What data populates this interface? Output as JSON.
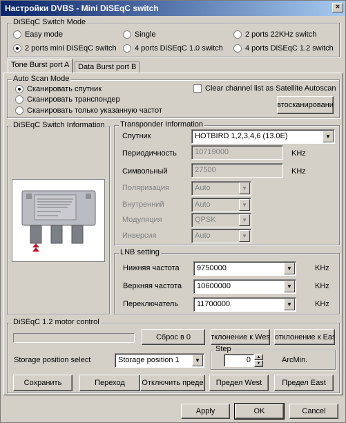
{
  "window": {
    "title": "Настройки DVBS - Mini DiSEqC switch",
    "close_glyph": "×"
  },
  "switch_mode": {
    "legend": "DiSEqC Switch Mode",
    "options": [
      {
        "label": "Easy mode",
        "checked": false
      },
      {
        "label": "Single",
        "checked": false
      },
      {
        "label": "2 ports 22KHz switch",
        "checked": false
      },
      {
        "label": "2 ports mini DiSEqC switch",
        "checked": true
      },
      {
        "label": "4 ports DiSEqC 1.0 switch",
        "checked": false
      },
      {
        "label": "4 ports DiSEqC 1.2 switch",
        "checked": false
      }
    ]
  },
  "tabs": [
    {
      "label": "Tone Burst port A",
      "active": true
    },
    {
      "label": "Data Burst port B",
      "active": false
    }
  ],
  "auto_scan": {
    "legend": "Auto Scan Mode",
    "options": [
      {
        "label": "Сканировать спутник",
        "checked": true
      },
      {
        "label": "Сканировать транспондер",
        "checked": false
      },
      {
        "label": "Сканировать только указанную частот",
        "checked": false
      }
    ],
    "clear_list_label": "Clear channel list as Satellite Autoscan",
    "autoscan_button": "втосканировани"
  },
  "switch_info": {
    "legend": "DiSEqC Switch Information"
  },
  "transponder": {
    "legend": "Transponder Information",
    "satellite_label": "Спутник",
    "satellite_value": "HOTBIRD 1,2,3,4,6 (13.0E)",
    "frequency_label": "Периодичность",
    "frequency_value": "10719000",
    "frequency_unit": "KHz",
    "symbol_label": "Символьный",
    "symbol_value": "27500",
    "symbol_unit": "KHz",
    "polarization_label": "Поляризация",
    "polarization_value": "Auto",
    "internal_label": "Внутренний",
    "internal_value": "Auto",
    "modulation_label": "Модуляция",
    "modulation_value": "QPSK",
    "inversion_label": "Инверсия",
    "inversion_value": "Auto"
  },
  "lnb": {
    "legend": "LNB setting",
    "low_label": "Нижняя частота",
    "low_value": "9750000",
    "low_unit": "KHz",
    "high_label": "Верхняя частота",
    "high_value": "10600000",
    "high_unit": "KHz",
    "switch_label": "Переключатель",
    "switch_value": "11700000",
    "switch_unit": "KHz"
  },
  "motor": {
    "legend": "DiSEqC 1.2 motor control",
    "reset_button": "Сброс в 0",
    "west_button": "тклонение к Wes",
    "east_button": "ютклонение к Eas",
    "storage_label": "Storage position select",
    "storage_value": "Storage position  1",
    "step_legend": "Step",
    "step_value": "0",
    "step_unit": "ArcMin.",
    "save_button": "Сохранить",
    "goto_button": "Переход",
    "disable_button": "Отключить преде",
    "limit_west_button": "Предел West",
    "limit_east_button": "Предел East"
  },
  "footer": {
    "apply": "Apply",
    "ok": "OK",
    "cancel": "Cancel"
  }
}
